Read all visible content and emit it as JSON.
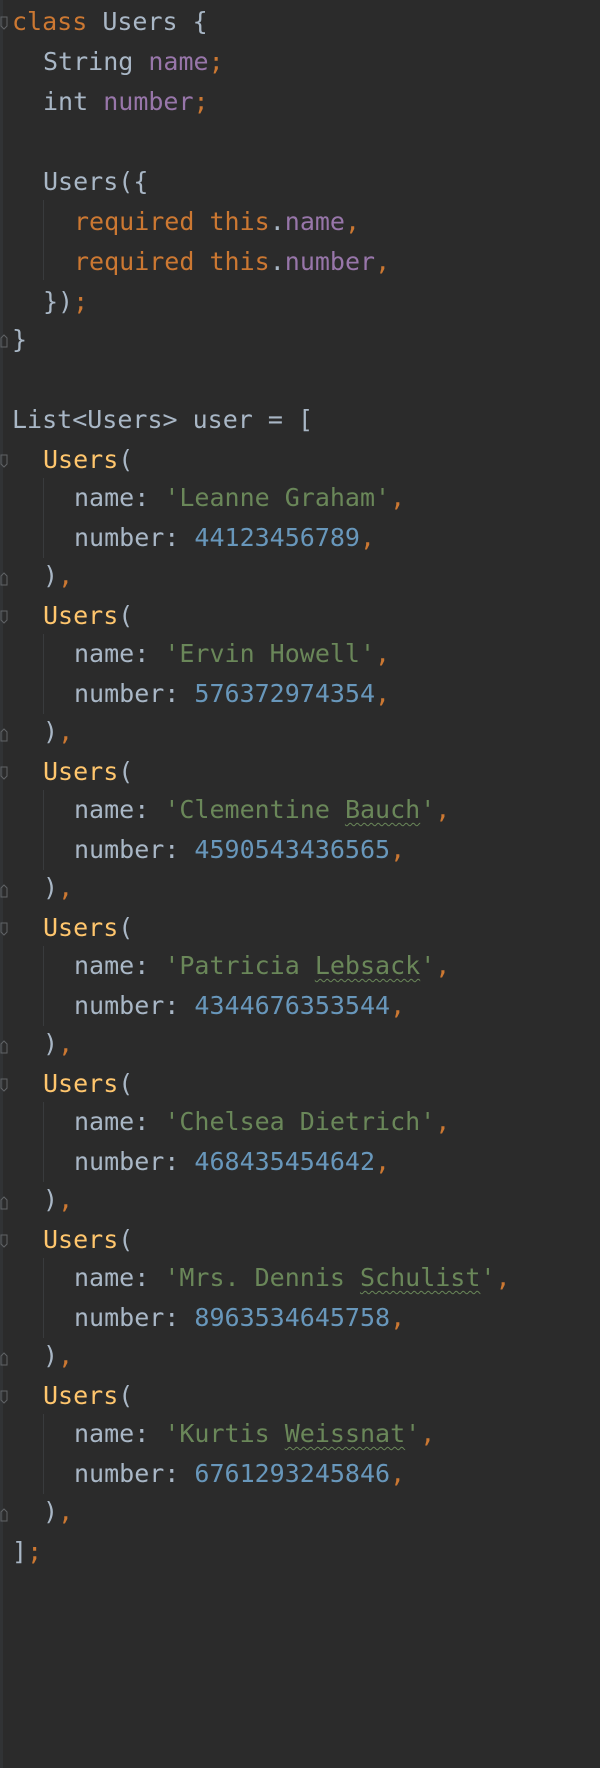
{
  "editor": {
    "class_decl": {
      "keyword": "class",
      "name": "Users",
      "open_brace": " {",
      "fields": [
        {
          "type": "String",
          "name": "name"
        },
        {
          "type": "int",
          "name": "number"
        }
      ],
      "constructor": {
        "name": "Users",
        "open": "({",
        "required_kw": "required",
        "this_kw": "this",
        "params": [
          "name",
          "number"
        ],
        "close": "});"
      },
      "close_brace": "}"
    },
    "list_decl": {
      "head": "List<Users> user = [",
      "close": "];",
      "ctor_name": "Users",
      "ctor_open": "(",
      "ctor_close": "),",
      "name_key": "name: ",
      "number_key": "number: ",
      "entries": [
        {
          "name": "'Leanne Graham'",
          "number": "44123456789"
        },
        {
          "name": "'Ervin Howell'",
          "number": "576372974354"
        },
        {
          "name_pre": "'Clementine ",
          "name_typo": "Bauch",
          "name_post": "'",
          "number": "4590543436565"
        },
        {
          "name_pre": "'Patricia ",
          "name_typo": "Lebsack",
          "name_post": "'",
          "number": "4344676353544"
        },
        {
          "name": "'Chelsea Dietrich'",
          "number": "468435454642"
        },
        {
          "name_pre": "'Mrs. Dennis ",
          "name_typo": "Schulist",
          "name_post": "'",
          "number": "8963534645758"
        },
        {
          "name_pre": "'Kurtis ",
          "name_typo": "Weissnat",
          "name_post": "'",
          "number": "6761293245846"
        }
      ]
    },
    "colors": {
      "background": "#2b2b2b",
      "plain": "#a9b7c6",
      "keyword": "#cc7832",
      "field": "#9876aa",
      "string": "#6a8759",
      "number": "#6897bb",
      "class_call": "#ffc66d"
    }
  }
}
